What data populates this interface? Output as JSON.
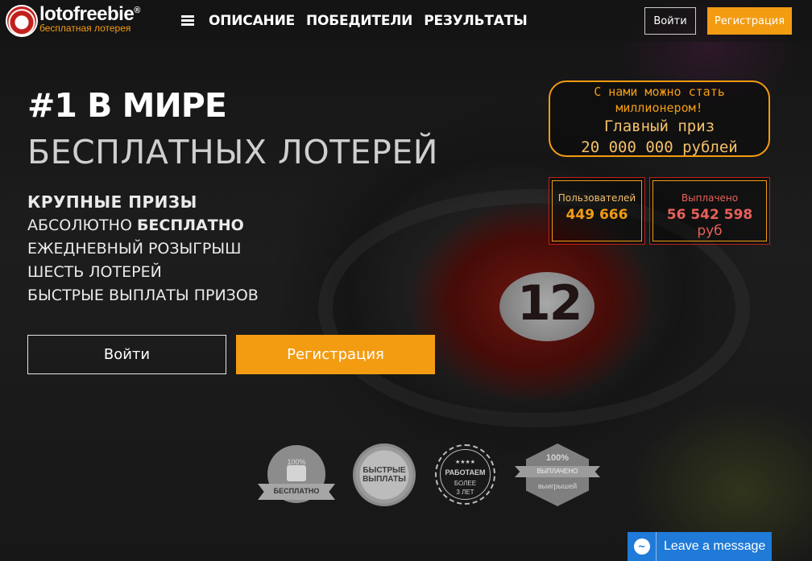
{
  "header": {
    "brand": "lotofreebie",
    "brand_mark": "®",
    "tagline": "бесплатная лотерея",
    "menu_icon": "hamburger-icon",
    "nav": [
      "Описание",
      "Победители",
      "Результаты"
    ],
    "login_label": "Войти",
    "register_label": "Регистрация"
  },
  "hero": {
    "title_bold": "#1 В МИРЕ",
    "title_thin": "БЕСПЛАТНЫХ ЛОТЕРЕЙ",
    "features": {
      "f1": "КРУПНЫЕ ПРИЗЫ",
      "f2_prefix": "АБСОЛЮТНО",
      "f2_bold": "БЕСПЛАТНО",
      "f3": "ЕЖЕДНЕВНЫЙ РОЗЫГРЫШ",
      "f4": "ШЕСТЬ ЛОТЕРЕЙ",
      "f5": "БЫСТРЫЕ ВЫПЛАТЫ ПРИЗОВ"
    },
    "login_label": "Войти",
    "register_label": "Регистрация"
  },
  "prize": {
    "line1": "С нами можно стать миллионером!",
    "line2": "Главный приз",
    "line3": "20 000 000 рублей"
  },
  "stats": {
    "users_label": "Пользователей",
    "users_value": "449 666",
    "paid_label": "Выплачено",
    "paid_value": "56 542 598",
    "paid_unit": "руб"
  },
  "badges": {
    "b1_percent": "100%",
    "b1_label": "БЕСПЛАТНО",
    "b2_label_1": "БЫСТРЫЕ",
    "b2_label_2": "ВЫПЛАТЫ",
    "b3_stars": "★★★★",
    "b3_label_1": "РАБОТАЕМ",
    "b3_label_2": "БОЛЕЕ",
    "b3_label_3": "3 ЛЕТ",
    "b4_percent": "100%",
    "b4_label_1": "ВЫПЛАЧЕНО",
    "b4_label_2": "выигрышей"
  },
  "chat": {
    "icon": "chat-bubble-icon",
    "label": "Leave a message"
  },
  "colors": {
    "accent": "#f39c12",
    "red": "#c0201b",
    "chat_blue": "#1f7ad8"
  }
}
